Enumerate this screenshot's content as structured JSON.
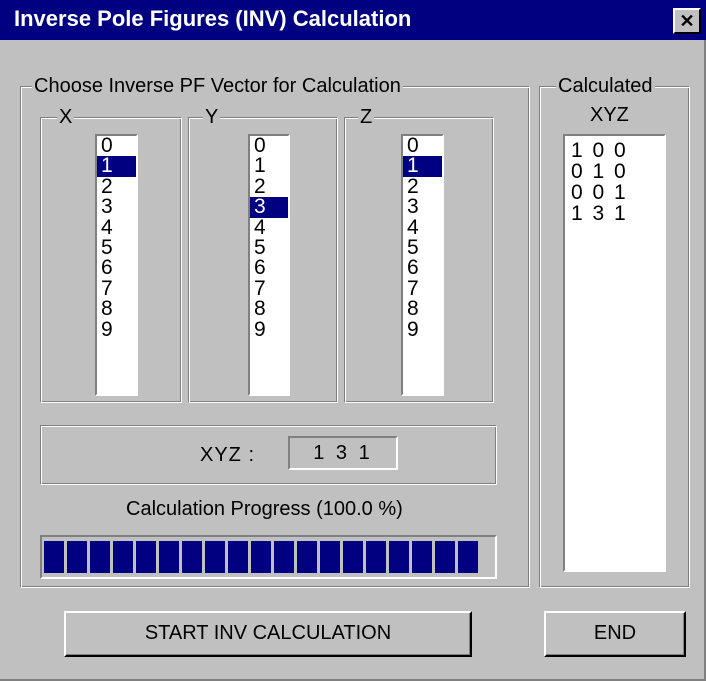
{
  "window": {
    "title": "Inverse Pole Figures (INV) Calculation",
    "close_glyph": "✕"
  },
  "choose_group": {
    "label": "Choose Inverse PF  Vector for Calculation",
    "columns": [
      {
        "axis": "X",
        "items": [
          "0",
          "1",
          "2",
          "3",
          "4",
          "5",
          "6",
          "7",
          "8",
          "9"
        ],
        "selected": "1"
      },
      {
        "axis": "Y",
        "items": [
          "0",
          "1",
          "2",
          "3",
          "4",
          "5",
          "6",
          "7",
          "8",
          "9"
        ],
        "selected": "3"
      },
      {
        "axis": "Z",
        "items": [
          "0",
          "1",
          "2",
          "3",
          "4",
          "5",
          "6",
          "7",
          "8",
          "9"
        ],
        "selected": "1"
      }
    ]
  },
  "xyz": {
    "label": "XYZ :",
    "value": "1 3 1"
  },
  "progress": {
    "label": "Calculation Progress   (100.0 %)",
    "fraction": 1.0,
    "color": "#000080"
  },
  "calculated": {
    "label": "Calculated",
    "header": "XYZ",
    "items": [
      "1 0 0",
      "0 1 0",
      "0 0 1",
      "1 3 1"
    ]
  },
  "buttons": {
    "start": "START INV CALCULATION",
    "end": "END"
  }
}
